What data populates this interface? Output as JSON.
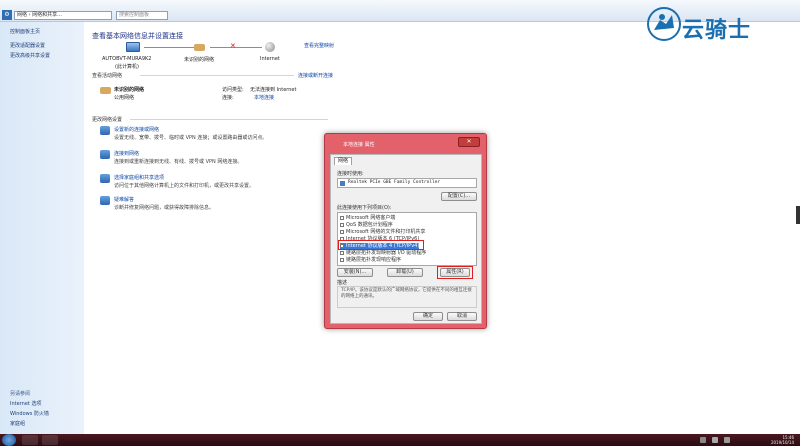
{
  "address": {
    "path": "网络 › 网络和共享...",
    "search_placeholder": "搜索控制面板"
  },
  "watermark": {
    "text": "云骑士"
  },
  "sidebar": {
    "items": [
      {
        "label": "控制面板主页"
      },
      {
        "label": "更改适配器设置"
      },
      {
        "label": "更改高级共享设置"
      }
    ],
    "see_also_head": "另请参阅",
    "see_also": [
      {
        "label": "Internet 选项"
      },
      {
        "label": "Windows 防火墙"
      },
      {
        "label": "家庭组"
      }
    ]
  },
  "main": {
    "title": "查看基本网络信息并设置连接",
    "view_full_map": "查看完整映射",
    "map": {
      "computer": "AUTOBVT-MURA9K2",
      "computer_sub": "(此计算机)",
      "network": "未识别的网络",
      "internet": "Internet"
    },
    "active_head": "查看活动网络",
    "connect_disconnect": "连接或断开连接",
    "net_name": "未识别的网络",
    "net_type": "公用网络",
    "access_type_label": "访问类型:",
    "access_type_value": "无法连接到 Internet",
    "connections_label": "连接:",
    "connections_value": "本地连接",
    "change_head": "更改网络设置",
    "tasks": [
      {
        "title": "设置新的连接或网络",
        "desc": "设置无线、宽带、拨号、临时或 VPN 连接；或设置路由器或访问点。"
      },
      {
        "title": "连接到网络",
        "desc": "连接到或重新连接到无线、有线、拨号或 VPN 网络连接。"
      },
      {
        "title": "选择家庭组和共享选项",
        "desc": "访问位于其他网络计算机上的文件和打印机，或更改共享设置。"
      },
      {
        "title": "疑难解答",
        "desc": "诊断并修复网络问题，或获得故障排除信息。"
      }
    ]
  },
  "dialog": {
    "title": "本地连接 属性",
    "close": "✕",
    "tab": "网络",
    "connect_using_label": "连接时使用:",
    "adapter": "Realtek PCIe GBE Family Controller",
    "configure_btn": "配置(C)...",
    "items_label": "此连接使用下列项目(O):",
    "items": [
      {
        "label": "Microsoft 网络客户端",
        "selected": false
      },
      {
        "label": "QoS 数据包计划程序",
        "selected": false
      },
      {
        "label": "Microsoft 网络的文件和打印机共享",
        "selected": false
      },
      {
        "label": "Internet 协议版本 6 (TCP/IPv6)",
        "selected": false
      },
      {
        "label": "Internet 协议版本 4 (TCP/IPv4)",
        "selected": true
      },
      {
        "label": "链路层拓扑发现映射器 I/O 驱动程序",
        "selected": false
      },
      {
        "label": "链路层拓扑发现响应程序",
        "selected": false
      }
    ],
    "install_btn": "安装(N)...",
    "uninstall_btn": "卸载(U)",
    "properties_btn": "属性(R)",
    "desc_label": "描述",
    "desc_text": "TCP/IP。该协议是默认的广域网络协议，它提供在不同的相互连接的网络上的通讯。",
    "ok_btn": "确定",
    "cancel_btn": "取消"
  },
  "taskbar": {
    "time": "15:46",
    "date": "2019/10/14"
  }
}
